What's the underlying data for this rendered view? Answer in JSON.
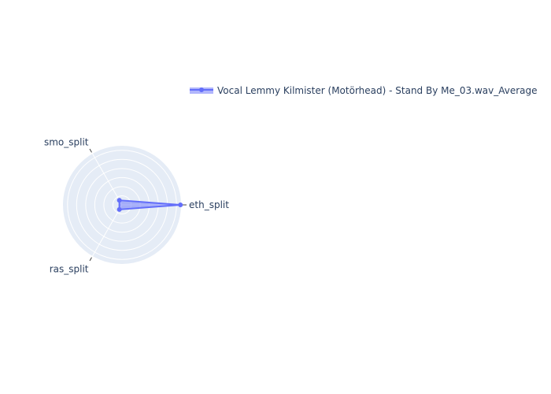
{
  "chart_data": {
    "type": "radar",
    "axes": [
      "eth_split",
      "smo_split",
      "ras_split"
    ],
    "radial_range": [
      0,
      1
    ],
    "grid": true,
    "legend_position": "top-right",
    "series": [
      {
        "name": "Vocal Lemmy Kilmister (Motörhead) - Stand By Me_03.wav_Average",
        "values": [
          0.99,
          0.09,
          0.09
        ],
        "color": "#636efa"
      }
    ]
  }
}
